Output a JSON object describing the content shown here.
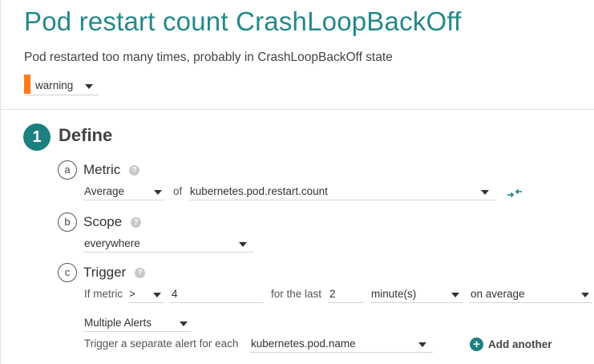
{
  "alert": {
    "title": "Pod restart count CrashLoopBackOff",
    "description": "Pod restarted too many times, probably in CrashLoopBackOff state",
    "severity": "warning",
    "severity_color": "#ff7a1a"
  },
  "define": {
    "step_number": "1",
    "title": "Define",
    "metric": {
      "letter": "a",
      "title": "Metric",
      "aggregation": "Average",
      "of_label": "of",
      "metric_name": "kubernetes.pod.restart.count"
    },
    "scope": {
      "letter": "b",
      "title": "Scope",
      "value": "everywhere"
    },
    "trigger": {
      "letter": "c",
      "title": "Trigger",
      "if_metric_label": "If metric",
      "operator": ">",
      "threshold": "4",
      "for_the_last_label": "for the last",
      "duration": "2",
      "unit": "minute(s)",
      "aggregation": "on average",
      "alert_mode": "Multiple Alerts",
      "separate_label": "Trigger a separate alert for each",
      "segment_by": "kubernetes.pod.name",
      "add_another_label": "Add another"
    }
  },
  "colors": {
    "accent": "#26888a",
    "step_circle": "#1c7f80"
  }
}
